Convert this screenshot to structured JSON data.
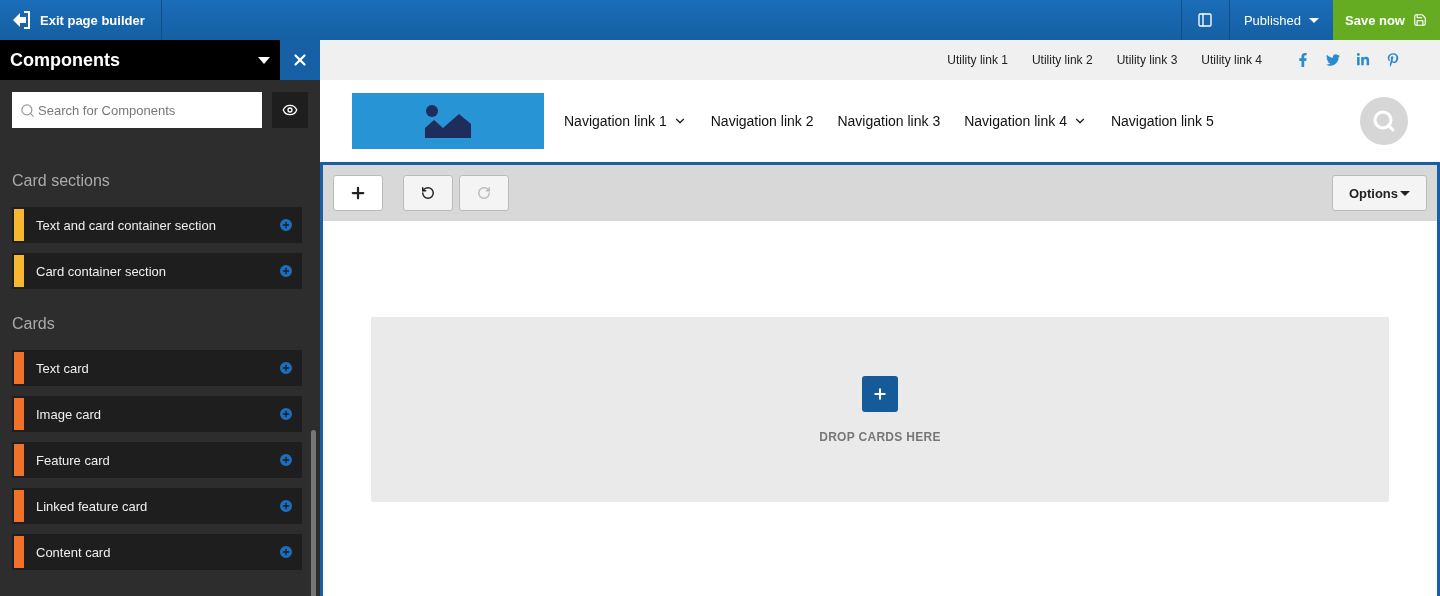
{
  "topbar": {
    "exit_label": "Exit page builder",
    "status": "Published",
    "save_label": "Save now"
  },
  "sidebar": {
    "title": "Components",
    "search": {
      "placeholder": "Search for Components"
    },
    "groups": [
      {
        "title": "Card sections",
        "color": "#f7b731",
        "items": [
          "Text and card container section",
          "Card container section"
        ]
      },
      {
        "title": "Cards",
        "color": "#f0712a",
        "items": [
          "Text card",
          "Image card",
          "Feature card",
          "Linked feature card",
          "Content card"
        ]
      }
    ]
  },
  "utility_links": [
    "Utility link 1",
    "Utility link 2",
    "Utility link 3",
    "Utility link 4"
  ],
  "nav_links": [
    {
      "label": "Navigation link 1",
      "dropdown": true
    },
    {
      "label": "Navigation link 2",
      "dropdown": false
    },
    {
      "label": "Navigation link 3",
      "dropdown": false
    },
    {
      "label": "Navigation link 4",
      "dropdown": true
    },
    {
      "label": "Navigation link 5",
      "dropdown": false
    }
  ],
  "builder": {
    "undo_disabled": false,
    "redo_disabled": true,
    "options_label": "Options",
    "drop_label": "DROP CARDS HERE"
  }
}
